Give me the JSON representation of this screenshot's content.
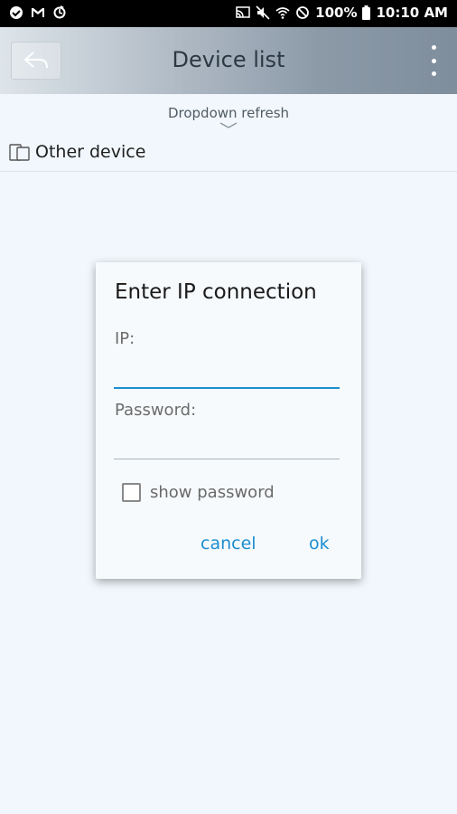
{
  "status_bar": {
    "battery": "100%",
    "time": "10:10 AM",
    "left_icons": [
      "app-notification-icon",
      "gmail-icon",
      "sync-icon"
    ],
    "right_icons": [
      "cast-icon",
      "mute-icon",
      "wifi-icon",
      "block-icon",
      "battery-icon"
    ]
  },
  "header": {
    "title": "Device list",
    "back_icon": "back-arrow-icon",
    "menu_icon": "overflow-menu-icon"
  },
  "list": {
    "refresh_hint": "Dropdown refresh",
    "devices": [
      {
        "label": "Other device",
        "icon": "device-icon"
      }
    ]
  },
  "dialog": {
    "title": "Enter IP connection",
    "ip_label": "IP:",
    "ip_value": "",
    "password_label": "Password:",
    "password_value": "",
    "show_password_label": "show password",
    "show_password_checked": false,
    "cancel_label": "cancel",
    "ok_label": "ok"
  },
  "colors": {
    "accent": "#1c8ed2",
    "background": "#f1f7fc",
    "status_bar": "#000000"
  }
}
